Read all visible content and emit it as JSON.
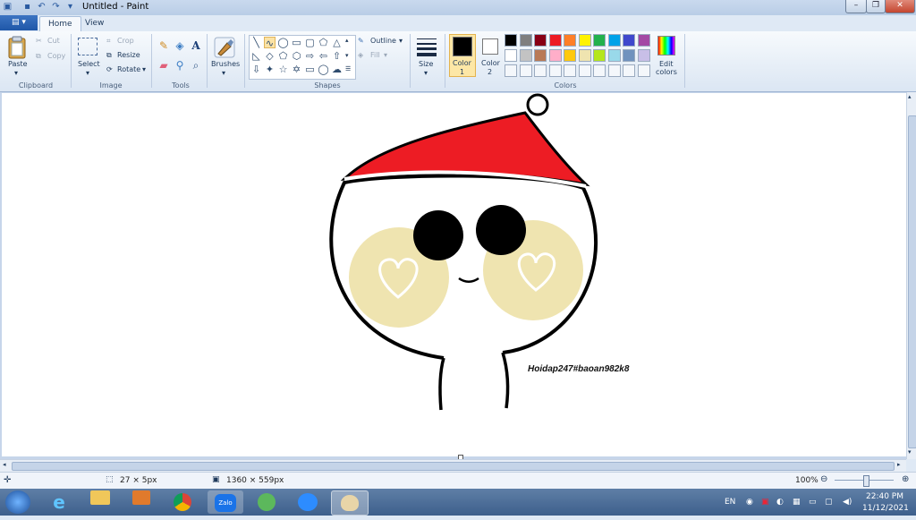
{
  "window": {
    "title": "Untitled - Paint",
    "controls": {
      "minimize": "–",
      "maximize": "❐",
      "close": "✕"
    }
  },
  "quick_access": [
    "save-icon",
    "undo-icon",
    "redo-icon",
    "customize-icon"
  ],
  "tabs": {
    "file": "▤ ▾",
    "home": "Home",
    "view": "View"
  },
  "clipboard": {
    "paste": "Paste",
    "cut": "Cut",
    "copy": "Copy",
    "group": "Clipboard"
  },
  "image": {
    "select": "Select",
    "crop": "Crop",
    "resize": "Resize",
    "rotate": "Rotate",
    "group": "Image"
  },
  "tools": {
    "group": "Tools",
    "text_tool": "A"
  },
  "brushes": {
    "label": "Brushes"
  },
  "shapes": {
    "outline": "Outline",
    "fill": "Fill",
    "group": "Shapes"
  },
  "size": {
    "label": "Size"
  },
  "colors": {
    "color1_label": "Color",
    "color1_num": "1",
    "color2_label": "Color",
    "color2_num": "2",
    "edit_label1": "Edit",
    "edit_label2": "colors",
    "group": "Colors",
    "color1": "#000000",
    "color2": "#ffffff",
    "palette_row1": [
      "#000000",
      "#7f7f7f",
      "#880015",
      "#ed1c24",
      "#ff7f27",
      "#fff200",
      "#22b14c",
      "#00a2e8",
      "#3f48cc",
      "#a349a4"
    ],
    "palette_row2": [
      "#ffffff",
      "#c3c3c3",
      "#b97a57",
      "#ffaec9",
      "#ffc90e",
      "#efe4b0",
      "#b5e61d",
      "#99d9ea",
      "#7092be",
      "#c8bfe7"
    ]
  },
  "drawing": {
    "signature": "Hoidap247#baoan982k8",
    "hat_color": "#ed1c24",
    "cheek_color": "#efe4b0"
  },
  "status": {
    "selection_size": "27 × 5px",
    "canvas_size": "1360 × 559px",
    "zoom": "100%"
  },
  "taskbar": {
    "apps": [
      "start-icon",
      "ie-icon",
      "explorer-icon",
      "media-icon",
      "chrome-icon",
      "zalo-icon",
      "coccoc-icon",
      "zoom-icon",
      "paint-icon"
    ],
    "zalo_label": "Zalo",
    "language": "EN",
    "time": "22:40 PM",
    "date": "11/12/2021"
  }
}
